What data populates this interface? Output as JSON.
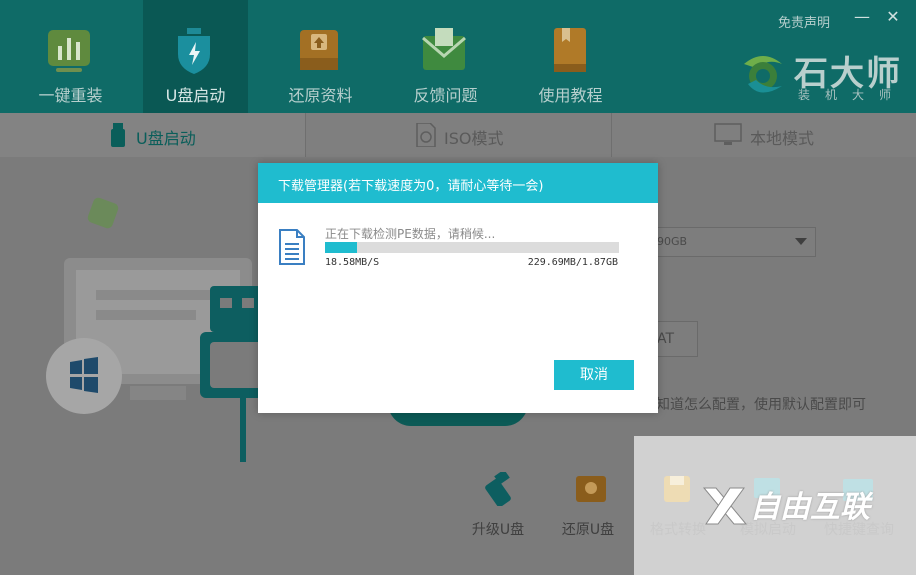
{
  "header": {
    "nav": [
      {
        "label": "一键重装",
        "icon": "bar-chart-icon",
        "color": "#7cc24b"
      },
      {
        "label": "U盘启动",
        "icon": "usb-shield-icon",
        "color": "#1fbccf"
      },
      {
        "label": "还原资料",
        "icon": "restore-icon",
        "color": "#e8a020"
      },
      {
        "label": "反馈问题",
        "icon": "mail-icon",
        "color": "#5cb85c"
      },
      {
        "label": "使用教程",
        "icon": "book-icon",
        "color": "#e8a020"
      }
    ],
    "disclaimer": "免责声明",
    "minimize": "—",
    "close": "✕",
    "brand": {
      "name": "石大师",
      "subtitle": "装机大师"
    }
  },
  "tabs": [
    {
      "label": "U盘启动",
      "icon": "usb-drive-icon"
    },
    {
      "label": "ISO模式",
      "icon": "iso-file-icon"
    },
    {
      "label": "本地模式",
      "icon": "monitor-icon"
    }
  ],
  "main": {
    "dropdown_value": "90GB",
    "format_value": "AT",
    "hint": "知道怎么配置，使用默认配置即可",
    "tools": [
      {
        "label": "升级U盘",
        "icon": "usb-upgrade-icon"
      },
      {
        "label": "还原U盘",
        "icon": "usb-restore-icon"
      },
      {
        "label": "格式转换",
        "icon": "save-icon"
      },
      {
        "label": "模拟启动",
        "icon": "simulate-icon"
      },
      {
        "label": "快捷键查询",
        "icon": "keyboard-icon"
      }
    ],
    "watermark": "自由互联"
  },
  "dialog": {
    "title": "下载管理器(若下载速度为0，请耐心等待一会)",
    "status": "正在下载检测PE数据，请稍候...",
    "progress_percent": 11,
    "speed": "18.58MB/S",
    "size": "229.69MB/1.87GB",
    "cancel_label": "取消",
    "accent_color": "#1fbccf"
  }
}
